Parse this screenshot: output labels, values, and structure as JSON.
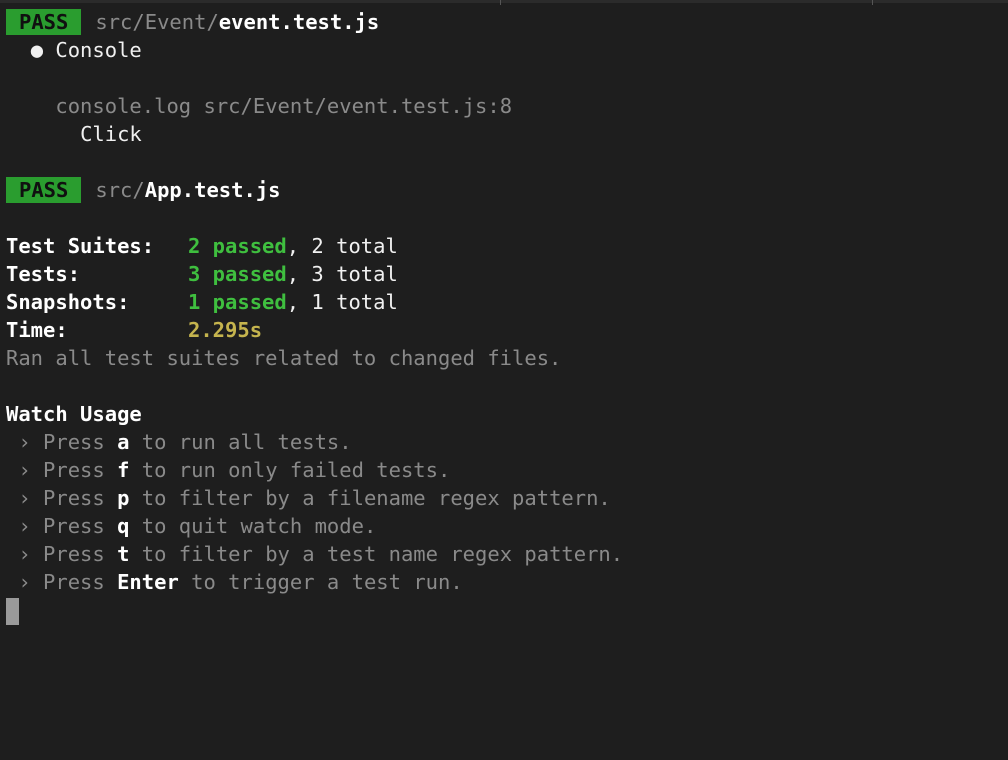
{
  "suite1": {
    "badge": "PASS",
    "path_dim": "src/Event/",
    "file": "event.test.js",
    "bullet": "●",
    "console_label": "Console",
    "console_log": "console.log src/Event/event.test.js:8",
    "log_output": "Click"
  },
  "suite2": {
    "badge": "PASS",
    "path_dim": "src/",
    "file": "App.test.js"
  },
  "summary": {
    "suites_label": "Test Suites:",
    "suites_passed": "2 passed",
    "suites_total": ", 2 total",
    "tests_label": "Tests:",
    "tests_passed": "3 passed",
    "tests_total": ", 3 total",
    "snapshots_label": "Snapshots:",
    "snapshots_passed": "1 passed",
    "snapshots_total": ", 1 total",
    "time_label": "Time:",
    "time_value": "2.295s",
    "ran_text": "Ran all test suites related to changed files."
  },
  "watch": {
    "title": "Watch Usage",
    "arrow": "›",
    "press": "Press",
    "items": [
      {
        "key": "a",
        "desc": "to run all tests."
      },
      {
        "key": "f",
        "desc": "to run only failed tests."
      },
      {
        "key": "p",
        "desc": "to filter by a filename regex pattern."
      },
      {
        "key": "q",
        "desc": "to quit watch mode."
      },
      {
        "key": "t",
        "desc": "to filter by a test name regex pattern."
      },
      {
        "key": "Enter",
        "desc": "to trigger a test run."
      }
    ]
  },
  "colors": {
    "background": "#1e1e1e",
    "pass_badge": "#2a9d2f",
    "passed_text": "#3fbf3f",
    "time_text": "#c5b44e",
    "dim_text": "#8a8a8a"
  }
}
